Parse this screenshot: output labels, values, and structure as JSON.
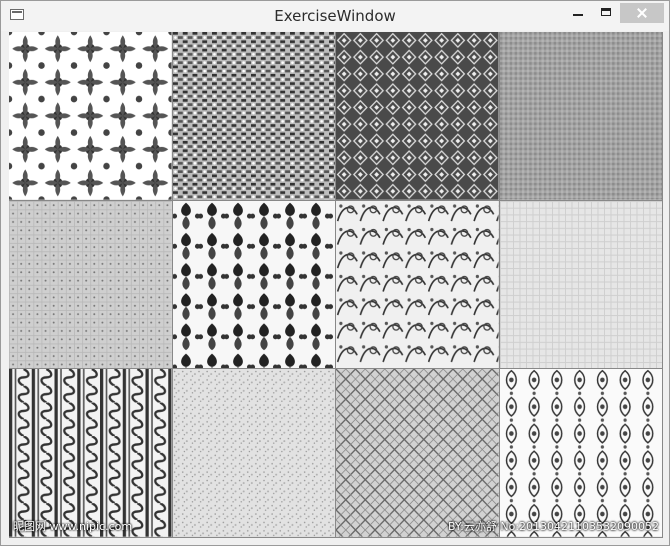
{
  "window": {
    "title": "ExerciseWindow"
  },
  "tiles": [
    {
      "pattern": "floral-damask-white"
    },
    {
      "pattern": "dense-lace"
    },
    {
      "pattern": "dark-diamond-lattice"
    },
    {
      "pattern": "gray-fine-weave"
    },
    {
      "pattern": "light-dotted-grid"
    },
    {
      "pattern": "baroque-scroll"
    },
    {
      "pattern": "paisley-vines"
    },
    {
      "pattern": "light-mesh"
    },
    {
      "pattern": "vertical-scroll-stripes"
    },
    {
      "pattern": "light-noise"
    },
    {
      "pattern": "diagonal-lattice"
    },
    {
      "pattern": "ornate-damask"
    }
  ],
  "watermarks": {
    "left": "昵图网 www.nipic.com",
    "right": "BY:云亦舒 No:20130421103532090052"
  }
}
